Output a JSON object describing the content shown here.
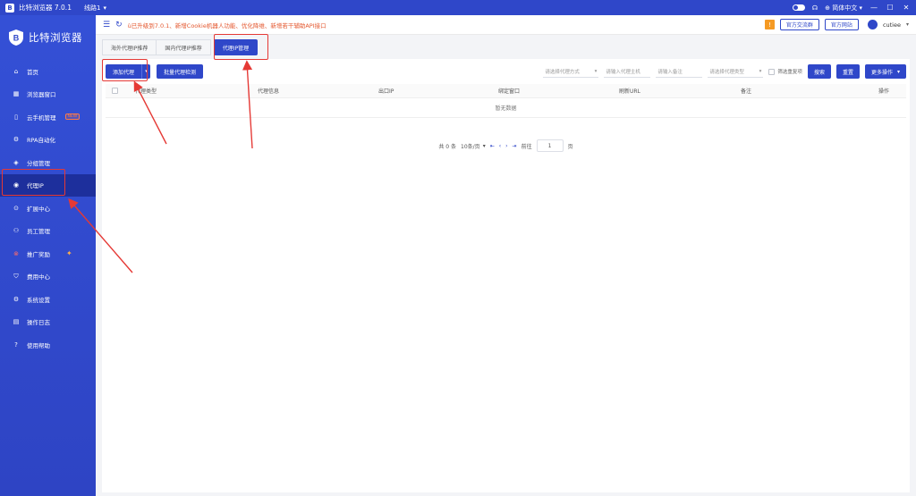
{
  "titlebar": {
    "title": "比特浏览器 7.0.1",
    "line": "线路1",
    "language": "简体中文",
    "min_label": "—",
    "max_label": "☐",
    "close_label": "✕"
  },
  "brand": {
    "name": "比特浏览器"
  },
  "sidebar": {
    "items": [
      {
        "label": "首页",
        "icon": "home-icon"
      },
      {
        "label": "浏览器窗口",
        "icon": "grid-icon"
      },
      {
        "label": "云手机管理",
        "icon": "phone-icon",
        "badge": "NEW"
      },
      {
        "label": "RPA自动化",
        "icon": "robot-icon"
      },
      {
        "label": "分组管理",
        "icon": "layers-icon"
      },
      {
        "label": "代理IP",
        "icon": "location-icon",
        "active": true
      },
      {
        "label": "扩展中心",
        "icon": "extension-icon"
      },
      {
        "label": "员工管理",
        "icon": "users-icon"
      },
      {
        "label": "推广奖励",
        "icon": "reward-icon"
      },
      {
        "label": "费用中心",
        "icon": "wallet-icon"
      },
      {
        "label": "系统设置",
        "icon": "settings-icon"
      },
      {
        "label": "操作日志",
        "icon": "log-icon"
      },
      {
        "label": "使用帮助",
        "icon": "help-icon"
      }
    ]
  },
  "header": {
    "notice": "已升级到7.0.1、新增Cookie机器人功能、优化降维、新增若干辅助API接口",
    "notice_prefix": "ù",
    "buttons": [
      "官方交流群",
      "官方网站"
    ],
    "username": "cutiee"
  },
  "tabs": [
    {
      "label": "海外代理IP推荐"
    },
    {
      "label": "国内代理IP推荐"
    },
    {
      "label": "代理IP管理",
      "active": true
    }
  ],
  "toolbar": {
    "add_label": "添加代理",
    "batch_label": "批量代理检测",
    "proxy_method_placeholder": "请选择代理方式",
    "host_placeholder": "请输入代理主机",
    "remark_placeholder": "请输入备注",
    "proxy_type_placeholder": "请选择代理类型",
    "dedupe_label": "筛选重复项",
    "search_label": "搜索",
    "reset_label": "重置",
    "more_label": "更多操作"
  },
  "table": {
    "columns": [
      "代理类型",
      "代理信息",
      "出口IP",
      "绑定窗口",
      "刷新URL",
      "备注",
      "操作"
    ],
    "empty_text": "暂无数据"
  },
  "pagination": {
    "total_text": "共 0 条",
    "page_size": "10条/页",
    "goto_label": "前往",
    "page_value": "1",
    "page_unit": "页"
  },
  "colors": {
    "primary": "#2f47c9",
    "sidebar_active": "#1d2f9c",
    "notice": "#e4572e",
    "annotation": "#e53935"
  }
}
